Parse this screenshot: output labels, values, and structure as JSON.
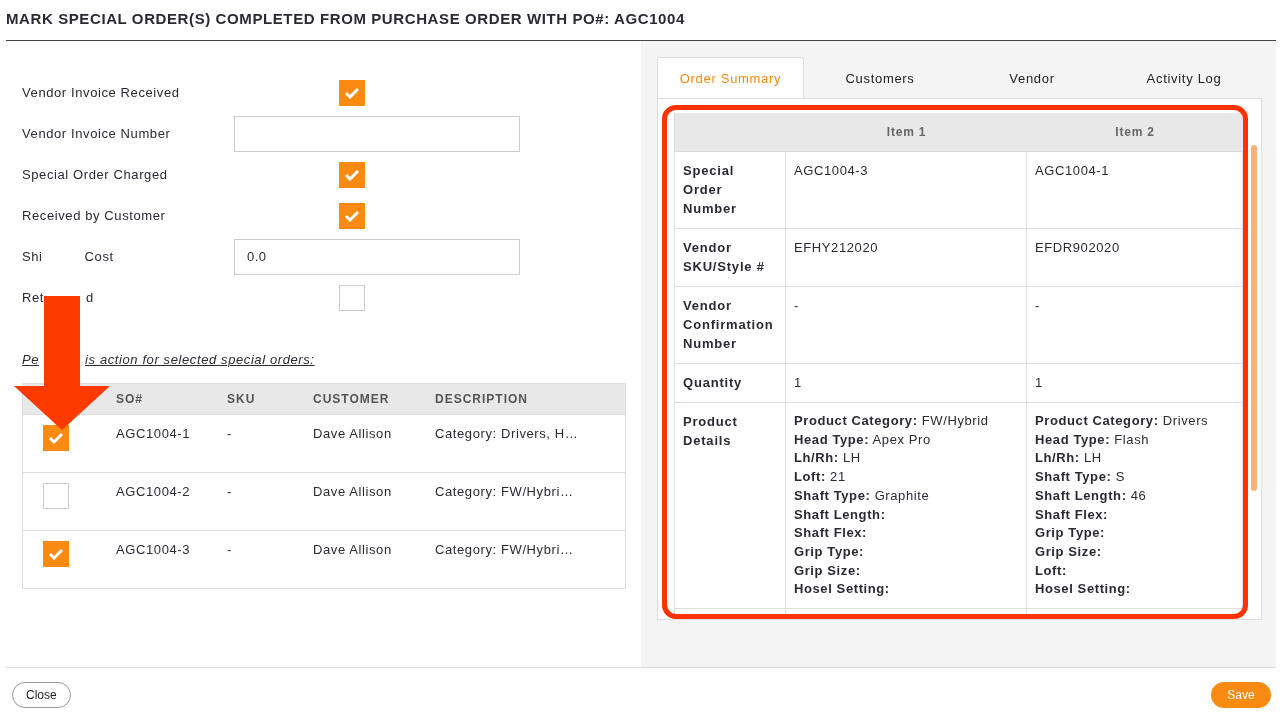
{
  "title": "MARK SPECIAL ORDER(S) COMPLETED FROM PURCHASE ORDER WITH PO#: AGC1004",
  "fields": [
    {
      "kind": "checkbox",
      "label": [
        "Vendor Invoice Received"
      ],
      "checked": true
    },
    {
      "kind": "text",
      "label": [
        "Vendor Invoice Number"
      ]
    },
    {
      "kind": "checkbox",
      "label": [
        "Special Order Charged"
      ],
      "checked": true
    },
    {
      "kind": "checkbox",
      "label": [
        "Received by Customer"
      ],
      "checked": true
    },
    {
      "kind": "text",
      "label": [
        "Shi",
        "Cost"
      ],
      "value": "0.0"
    },
    {
      "kind": "checkbox",
      "label": [
        "Ret",
        "d"
      ],
      "checked": false
    }
  ],
  "instruction": [
    "Pe",
    "is action for selected special orders:"
  ],
  "orders_table": {
    "columns": [
      "SO#",
      "SKU",
      "CUSTOMER",
      "DESCRIPTION"
    ],
    "rows": [
      {
        "checked": true,
        "cells": [
          "AGC1004-1",
          "-",
          "Dave Allison",
          "Category: Drivers, H…"
        ]
      },
      {
        "checked": false,
        "cells": [
          "AGC1004-2",
          "-",
          "Dave Allison",
          "Category: FW/Hybri…"
        ]
      },
      {
        "checked": true,
        "cells": [
          "AGC1004-3",
          "-",
          "Dave Allison",
          "Category: FW/Hybri…"
        ]
      }
    ]
  },
  "tabs": [
    {
      "label": "Order Summary",
      "selected": true
    },
    {
      "label": "Customers",
      "selected": false
    },
    {
      "label": "Vendor",
      "selected": false
    },
    {
      "label": "Activity Log",
      "selected": false
    }
  ],
  "summary": {
    "columns": [
      "Item 1",
      "Item 2"
    ],
    "rows": [
      {
        "kind": "plain",
        "label": "Special Order Number",
        "values": [
          "AGC1004-3",
          "AGC1004-1"
        ]
      },
      {
        "kind": "plain",
        "label": "Vendor SKU/Style #",
        "values": [
          "EFHY212020",
          "EFDR902020"
        ]
      },
      {
        "kind": "plain",
        "label": "Vendor Confirmation Number",
        "values": [
          "-",
          "-"
        ]
      },
      {
        "kind": "plain",
        "label": "Quantity",
        "values": [
          "1",
          "1"
        ]
      },
      {
        "kind": "details",
        "label": "Product Details",
        "lines": [
          [
            "**Product Category:** FW/Hybrid",
            "**Head Type:** Apex Pro",
            "**Lh/Rh:** LH",
            "**Loft:** 21",
            "**Shaft Type:** Graphite",
            "**Shaft Length:**",
            "**Shaft Flex:**",
            "**Grip Type:**",
            "**Grip Size:**",
            "**Hosel Setting:**"
          ],
          [
            "**Product Category:** Drivers",
            "**Head Type:** Flash",
            "**Lh/Rh:** LH",
            "**Shaft Type:** S",
            "**Shaft Length:** 46",
            "**Shaft Flex:**",
            "**Grip Type:**",
            "**Grip Size:**",
            "**Loft:**",
            "**Hosel Setting:**"
          ]
        ]
      }
    ]
  },
  "buttons": {
    "close": "Close",
    "save": "Save"
  }
}
